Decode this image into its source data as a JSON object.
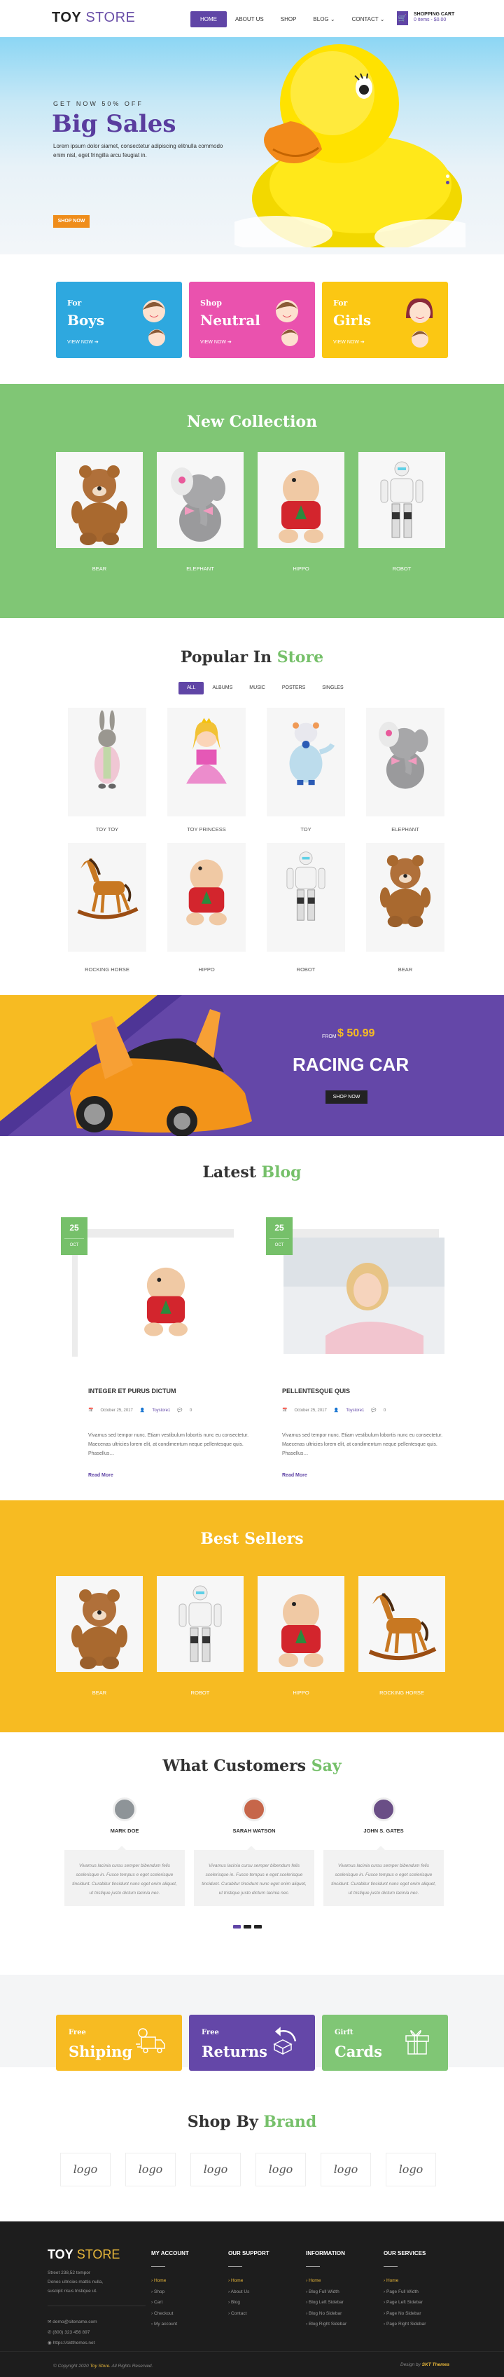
{
  "header": {
    "logo_bold": "TOY",
    "logo_light": "STORE",
    "nav": [
      {
        "label": "HOME",
        "active": true
      },
      {
        "label": "ABOUT US"
      },
      {
        "label": "SHOP"
      },
      {
        "label": "BLOG ⌄"
      },
      {
        "label": "CONTACT ⌄"
      }
    ],
    "cart": {
      "icon": "cart-icon",
      "title": "SHOPPING CART",
      "summary": "0 items - $0.00"
    }
  },
  "hero": {
    "kicker": "GET NOW 50% OFF",
    "title": "Big Sales",
    "text": "Lorem ipsum dolor siamet, consectetur adipiscing elitnulla commodo enim nisl, eget fringilla arcu feugiat in.",
    "button": "SHOP NOW",
    "slide_count": 2,
    "active_slide": 2
  },
  "categories": [
    {
      "kicker": "For",
      "title": "Boys",
      "link": "VIEW NOW ➔",
      "color": "#2ea8df"
    },
    {
      "kicker": "Shop",
      "title": "Neutral",
      "link": "VIEW NOW ➔",
      "color": "#ea52ae"
    },
    {
      "kicker": "For",
      "title": "Girls",
      "link": "VIEW NOW ➔",
      "color": "#fbc713"
    }
  ],
  "new_collection": {
    "title": "New Collection",
    "items": [
      {
        "label": "BEAR",
        "image": "bear"
      },
      {
        "label": "ELEPHANT",
        "image": "elephant"
      },
      {
        "label": "HIPPO",
        "image": "hippo"
      },
      {
        "label": "ROBOT",
        "image": "robot"
      }
    ]
  },
  "popular": {
    "title_a": "Popular In",
    "title_b": "Store",
    "tabs": [
      "ALL",
      "ALBUMS",
      "MUSIC",
      "POSTERS",
      "SINGLES"
    ],
    "active_tab": "ALL",
    "items": [
      {
        "label": "TOY TOY",
        "image": "rabbit"
      },
      {
        "label": "TOY PRINCESS",
        "image": "princess"
      },
      {
        "label": "TOY",
        "image": "cow"
      },
      {
        "label": "ELEPHANT",
        "image": "elephant"
      },
      {
        "label": "ROCKING HORSE",
        "image": "horse"
      },
      {
        "label": "HIPPO",
        "image": "hippo"
      },
      {
        "label": "ROBOT",
        "image": "robot"
      },
      {
        "label": "BEAR",
        "image": "bear"
      }
    ]
  },
  "promo": {
    "from": "FROM",
    "price": "$ 50.99",
    "title": "RACING CAR",
    "button": "SHOP NOW"
  },
  "blog": {
    "title_a": "Latest",
    "title_b": "Blog",
    "posts": [
      {
        "day": "25",
        "month": "OCT",
        "title": "INTEGER ET PURUS DICTUM",
        "date": "October 25, 2017",
        "author": "Toystore1",
        "comments": "0",
        "excerpt": "Vivamus sed tempor nunc. Etiam vestibulum lobortis nunc eu consectetur. Maecenas ultricies lorem elit, at condimentum neque pellentesque quis. Phasellus…",
        "read_more": "Read More"
      },
      {
        "day": "25",
        "month": "OCT",
        "title": "PELLENTESQUE QUIS",
        "date": "October 25, 2017",
        "author": "Toystore1",
        "comments": "0",
        "excerpt": "Vivamus sed tempor nunc. Etiam vestibulum lobortis nunc eu consectetur. Maecenas ultricies lorem elit, at condimentum neque pellentesque quis. Phasellus…",
        "read_more": "Read More"
      }
    ]
  },
  "best_sellers": {
    "title": "Best Sellers",
    "items": [
      {
        "label": "BEAR",
        "image": "bear"
      },
      {
        "label": "ROBOT",
        "image": "robot"
      },
      {
        "label": "HIPPO",
        "image": "hippo"
      },
      {
        "label": "ROCKING HORSE",
        "image": "horse"
      }
    ]
  },
  "testimonials": {
    "title_a": "What Customers",
    "title_b": "Say",
    "items": [
      {
        "name": "MARK DOE",
        "text": "Vivamus lacinia cursu semper bibendum felis scelerisque in. Fusce tempus e eget scelerisque tincidunt. Curabitur tincidunt nunc eget enim aliquet, ut tristique justo dictum lacinia nec."
      },
      {
        "name": "SARAH WATSON",
        "text": "Vivamus lacinia cursu semper bibendum felis scelerisque in. Fusce tempus e eget scelerisque tincidunt. Curabitur tincidunt nunc eget enim aliquet, ut tristique justo dictum lacinia nec."
      },
      {
        "name": "JOHN S. GATES",
        "text": "Vivamus lacinia cursu semper bibendum felis scelerisque in. Fusce tempus e eget scelerisque tincidunt. Curabitur tincidunt nunc eget enim aliquet, ut tristique justo dictum lacinia nec."
      }
    ],
    "page_count": 3,
    "active_page": 1
  },
  "features": [
    {
      "kicker": "Free",
      "title": "Shiping",
      "icon": "truck-icon",
      "color": "#f7bb22"
    },
    {
      "kicker": "Free",
      "title": "Returns",
      "icon": "return-box-icon",
      "color": "#6447a8"
    },
    {
      "kicker": "Girft",
      "title": "Cards",
      "icon": "gift-icon",
      "color": "#80c675"
    }
  ],
  "brands": {
    "title_a": "Shop By",
    "title_b": "Brand",
    "logos": [
      "logo",
      "logo",
      "logo",
      "logo",
      "logo",
      "logo"
    ]
  },
  "footer": {
    "logo_bold": "TOY",
    "logo_light": "STORE",
    "address": [
      "Street 238,52 tempor",
      "Donec ultricies mattis nulla,",
      "suscipit risus tristique ut."
    ],
    "email": "demo@sitename.com",
    "phone": "(800) 323 456 897",
    "website": "https://sktthemes.net",
    "columns": [
      {
        "title": "MY ACCOUNT",
        "links": [
          "Home",
          "Shop",
          "Cart",
          "Checkout",
          "My account"
        ]
      },
      {
        "title": "OUR SUPPORT",
        "links": [
          "Home",
          "About Us",
          "Blog",
          "Contact"
        ]
      },
      {
        "title": "INFORMATION",
        "links": [
          "Home",
          "Blog Full Width",
          "Blog Left Sidebar",
          "Blog No Sidebar",
          "Blog Right Sidebar"
        ]
      },
      {
        "title": "OUR SERVICES",
        "links": [
          "Home",
          "Page Full Width",
          "Page Left Sidebar",
          "Page No Sidebar",
          "Page Right Sidebar"
        ]
      }
    ],
    "copyright_pre": "© Copyright 2020",
    "copyright_brand": "Toy Store.",
    "copyright_post": "All Rights Reserved.",
    "design_pre": "Design by",
    "design_brand": "SKT Themes"
  }
}
